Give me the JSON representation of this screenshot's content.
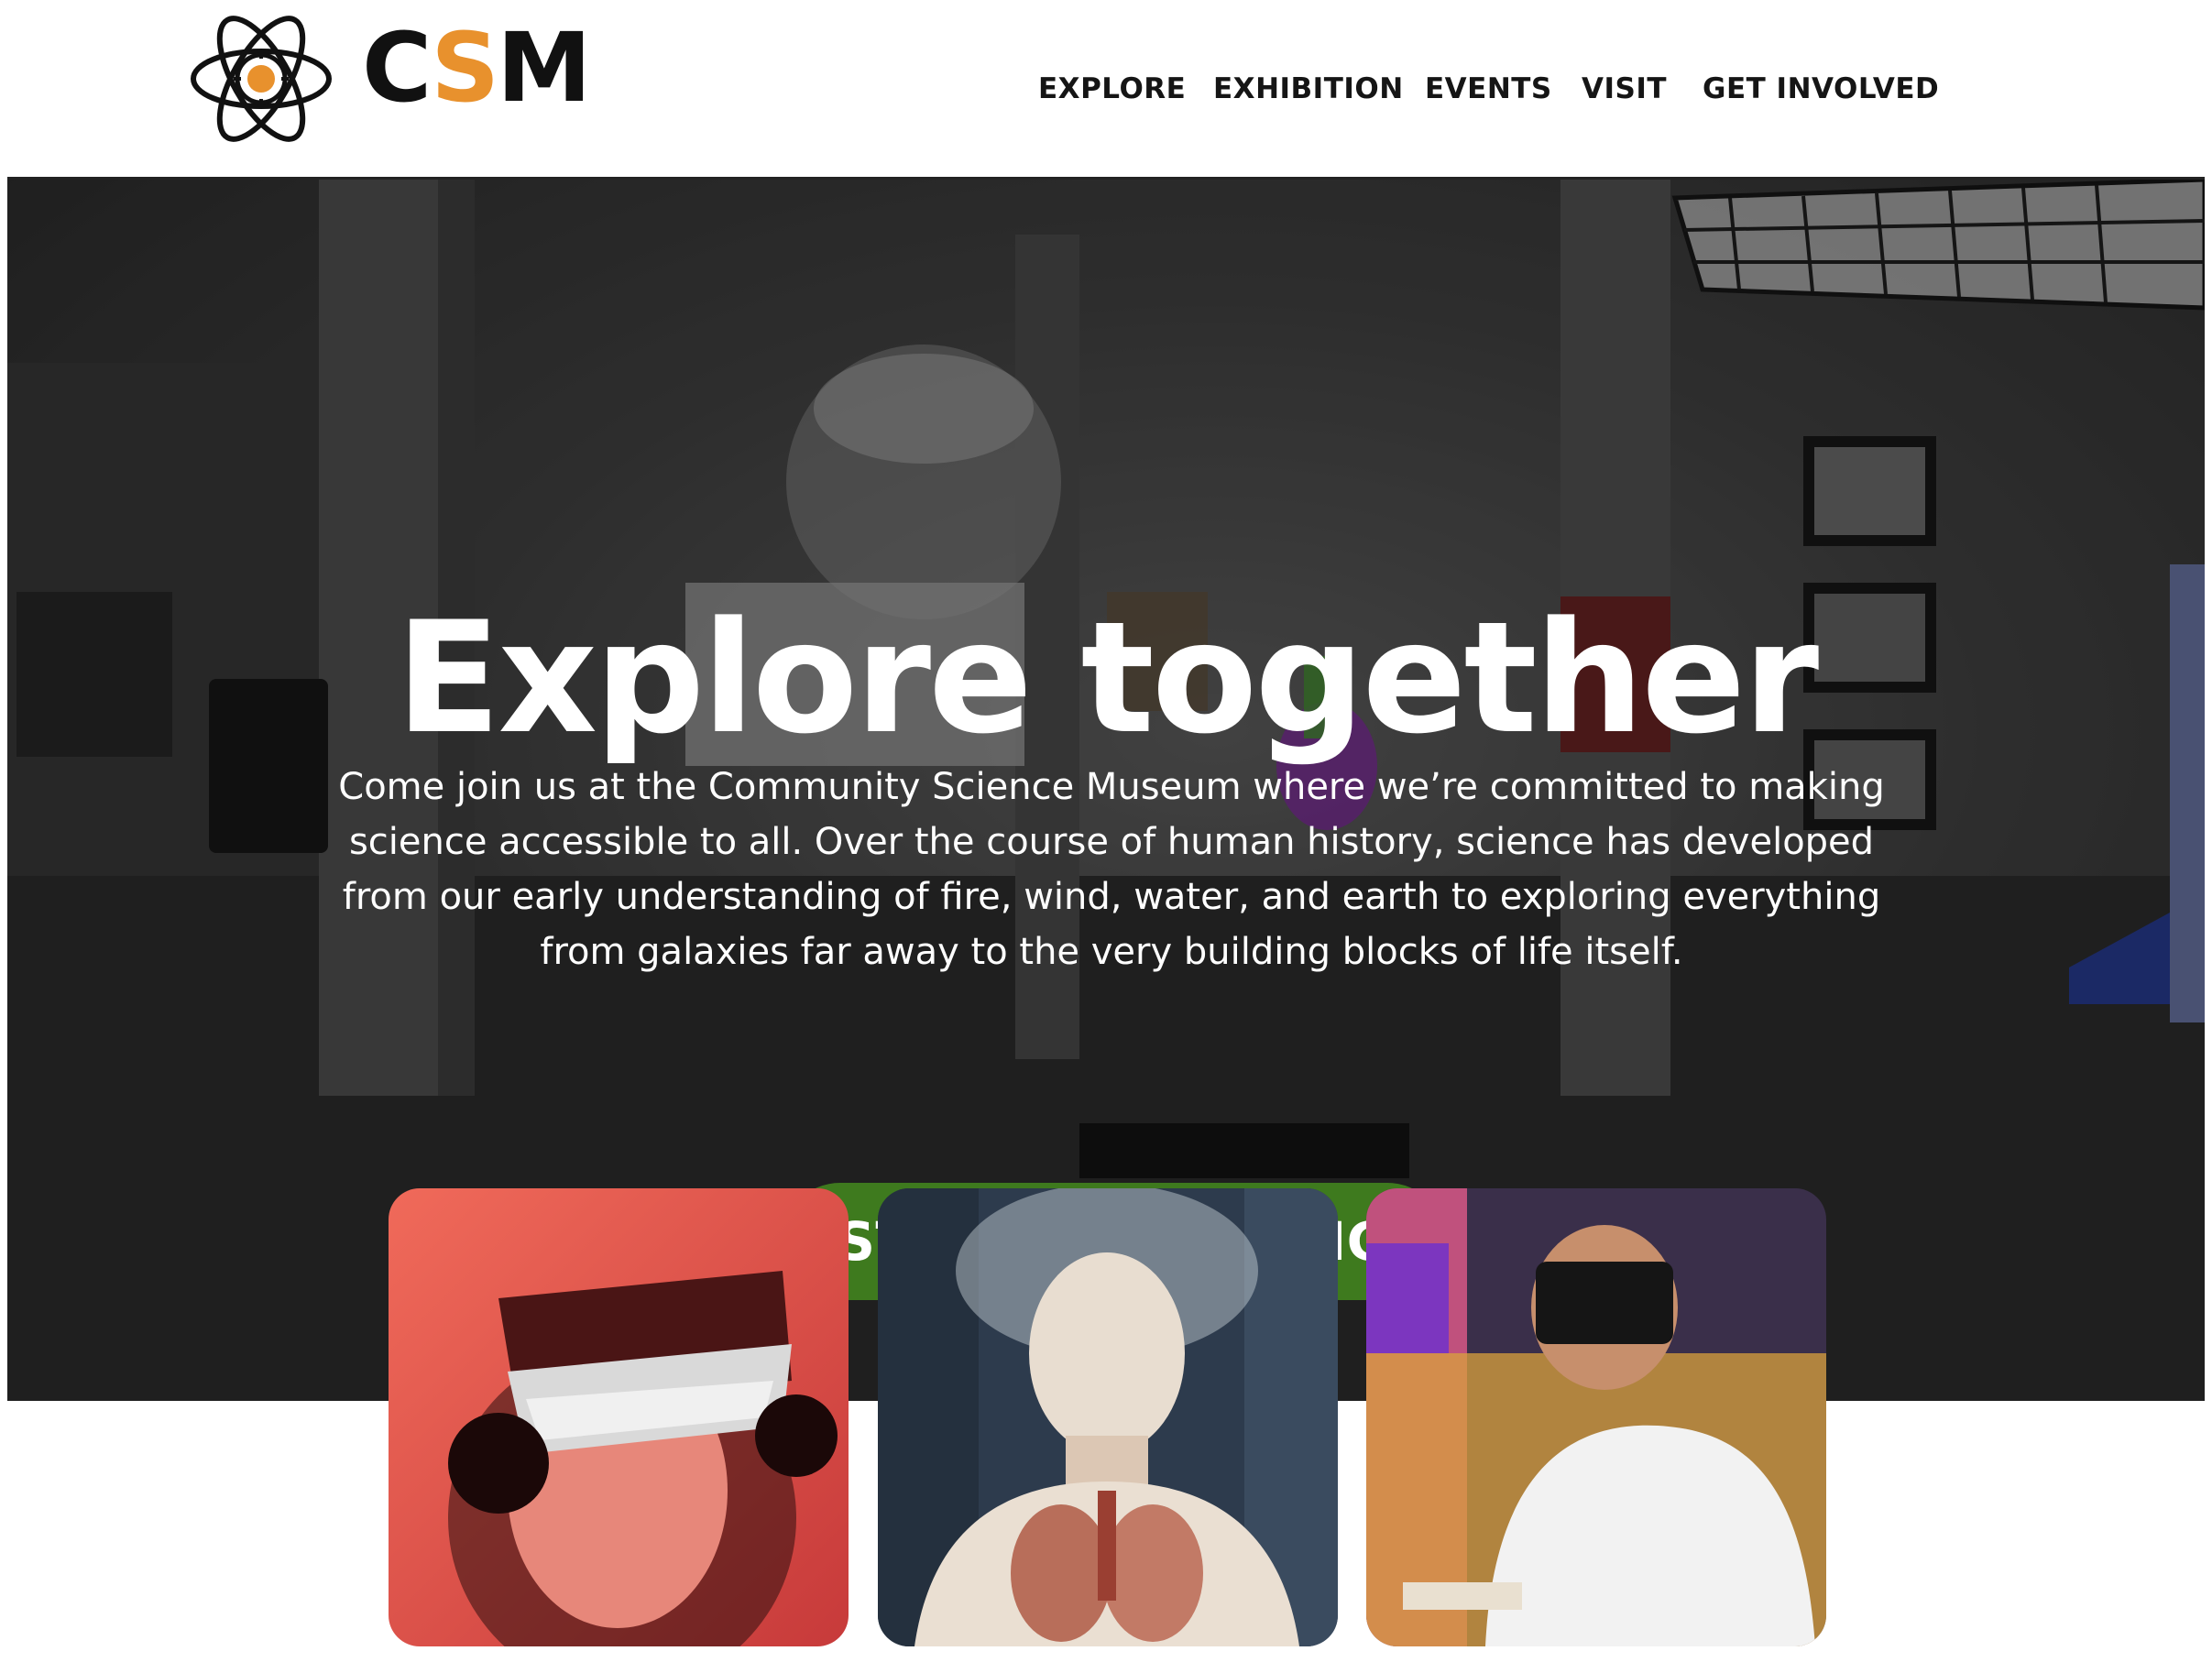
{
  "brand": {
    "name_left": "C",
    "name_accent": "S",
    "name_right": "M",
    "accent_color": "#e8912d"
  },
  "nav": {
    "items": [
      {
        "label": "EXPLORE"
      },
      {
        "label": "EXHIBITION"
      },
      {
        "label": "EVENTS"
      },
      {
        "label": "VISIT"
      },
      {
        "label": "GET INVOLVED"
      }
    ]
  },
  "hero": {
    "title": "Explore together",
    "description": "Come join us at the Community Science Museum where we’re committed to making science accessible to all. Over the course of human history, science has developed from our early understanding of fire, wind, water, and earth to exploring everything from galaxies far away to the very building blocks of life itself.",
    "cta_label": "START EXPLORING",
    "cta_color": "#3e7a1e"
  },
  "cards": [
    {
      "image": "person-wearing-vr-headset-red-tint"
    },
    {
      "image": "anatomical-torso-model"
    },
    {
      "image": "student-with-vr-headset"
    }
  ]
}
